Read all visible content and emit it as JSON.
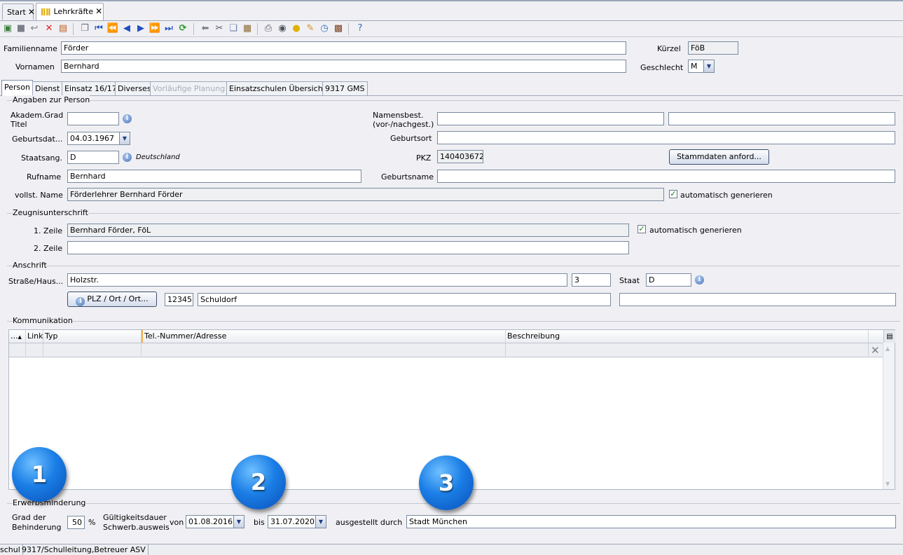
{
  "doc_tabs": [
    {
      "label": "Start",
      "close": "✕"
    },
    {
      "label": "Lehrkräfte",
      "close": "✕"
    }
  ],
  "toolbar_icons": [
    "new-record-icon",
    "save-icon",
    "undo-icon",
    "delete-icon",
    "discard-icon",
    "copy-record-icon",
    "first-icon",
    "prev-page-icon",
    "prev-icon",
    "next-icon",
    "next-page-icon",
    "last-icon",
    "refresh-icon",
    "back-icon",
    "cut-icon",
    "copy-icon",
    "paste-icon",
    "print-icon",
    "preview-icon",
    "hint-icon",
    "clean-icon",
    "clock-icon",
    "person-card-icon",
    "help-icon"
  ],
  "header": {
    "familienname_label": "Familienname",
    "familienname": "Förder",
    "vornamen_label": "Vornamen",
    "vornamen": "Bernhard",
    "kuerzel_label": "Kürzel",
    "kuerzel": "FöB",
    "geschlecht_label": "Geschlecht",
    "geschlecht": "M"
  },
  "form_tabs": [
    {
      "label": "Person",
      "active": true
    },
    {
      "label": "Dienst"
    },
    {
      "label": "Einsatz 16/17"
    },
    {
      "label": "Diverses"
    },
    {
      "label": "Vorläufige Planung",
      "disabled": true
    },
    {
      "label": "Einsatzschulen Übersicht"
    },
    {
      "label": "9317 GMS"
    }
  ],
  "person": {
    "group_title": "Angaben zur Person",
    "akadem_label": "Akadem.Grad\nTitel",
    "akadem_value": "",
    "namensbest_label": "Namensbest.\n(vor-/nachgest.)",
    "namensbest_vor": "",
    "namensbest_nach": "",
    "geburtsdatum_label": "Geburtsdat...",
    "geburtsdatum": "04.03.1967",
    "geburtsort_label": "Geburtsort",
    "geburtsort": "",
    "staatsang_label": "Staatsang.",
    "staatsang": "D",
    "staatsang_hint": "Deutschland",
    "pkz_label": "PKZ",
    "pkz": "140403672",
    "stammdaten_button": "Stammdaten anford...",
    "rufname_label": "Rufname",
    "rufname": "Bernhard",
    "geburtsname_label": "Geburtsname",
    "geburtsname": "",
    "vollst_name_label": "vollst. Name",
    "vollst_name": "Förderlehrer Bernhard Förder",
    "auto_generate_label": "automatisch generieren",
    "auto_generate_checked": true
  },
  "zeugnis": {
    "group_title": "Zeugnisunterschrift",
    "zeile1_label": "1. Zeile",
    "zeile1": "Bernhard Förder, FöL",
    "zeile2_label": "2. Zeile",
    "zeile2": "",
    "auto_generate_label": "automatisch generieren",
    "auto_generate_checked": true
  },
  "anschrift": {
    "group_title": "Anschrift",
    "strasse_label": "Straße/Haus...",
    "strasse": "Holzstr.",
    "hausnummer": "3",
    "staat_label": "Staat",
    "staat": "D",
    "plz_button": "PLZ / Ort / Ort...",
    "plz": "12345",
    "ort": "Schuldorf",
    "ortsteil": ""
  },
  "kommunikation": {
    "group_title": "Kommunikation",
    "columns": [
      "...",
      "Link",
      "Typ",
      "Tel.-Nummer/Adresse",
      "Beschreibung"
    ],
    "rows": []
  },
  "erwerb": {
    "group_title": "Erwerbsminderung",
    "grad_label": "Grad der\nBehinderung",
    "grad": "50",
    "percent": "%",
    "gueltig_label": "Gültigkeitsdauer\nSchwerb.ausweis",
    "von_label": "von",
    "von": "01.08.2016",
    "bis_label": "bis",
    "bis": "31.07.2020",
    "ausgestellt_label": "ausgestellt durch",
    "ausgestellt": "Stadt München"
  },
  "callouts": [
    "1",
    "2",
    "3"
  ],
  "statusbar": [
    "schul",
    "9317/Schulleitung,Betreuer ASV"
  ],
  "colors": {
    "accent": "#1a7ee6",
    "field_border": "#7a8a9e",
    "background": "#f0f0f4"
  }
}
